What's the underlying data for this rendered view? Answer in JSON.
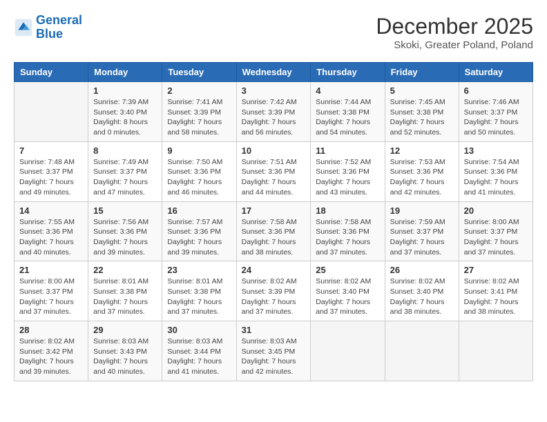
{
  "logo": {
    "text_general": "General",
    "text_blue": "Blue"
  },
  "title": "December 2025",
  "subtitle": "Skoki, Greater Poland, Poland",
  "headers": [
    "Sunday",
    "Monday",
    "Tuesday",
    "Wednesday",
    "Thursday",
    "Friday",
    "Saturday"
  ],
  "weeks": [
    [
      {
        "day": "",
        "info": ""
      },
      {
        "day": "1",
        "info": "Sunrise: 7:39 AM\nSunset: 3:40 PM\nDaylight: 8 hours\nand 0 minutes."
      },
      {
        "day": "2",
        "info": "Sunrise: 7:41 AM\nSunset: 3:39 PM\nDaylight: 7 hours\nand 58 minutes."
      },
      {
        "day": "3",
        "info": "Sunrise: 7:42 AM\nSunset: 3:39 PM\nDaylight: 7 hours\nand 56 minutes."
      },
      {
        "day": "4",
        "info": "Sunrise: 7:44 AM\nSunset: 3:38 PM\nDaylight: 7 hours\nand 54 minutes."
      },
      {
        "day": "5",
        "info": "Sunrise: 7:45 AM\nSunset: 3:38 PM\nDaylight: 7 hours\nand 52 minutes."
      },
      {
        "day": "6",
        "info": "Sunrise: 7:46 AM\nSunset: 3:37 PM\nDaylight: 7 hours\nand 50 minutes."
      }
    ],
    [
      {
        "day": "7",
        "info": "Sunrise: 7:48 AM\nSunset: 3:37 PM\nDaylight: 7 hours\nand 49 minutes."
      },
      {
        "day": "8",
        "info": "Sunrise: 7:49 AM\nSunset: 3:37 PM\nDaylight: 7 hours\nand 47 minutes."
      },
      {
        "day": "9",
        "info": "Sunrise: 7:50 AM\nSunset: 3:36 PM\nDaylight: 7 hours\nand 46 minutes."
      },
      {
        "day": "10",
        "info": "Sunrise: 7:51 AM\nSunset: 3:36 PM\nDaylight: 7 hours\nand 44 minutes."
      },
      {
        "day": "11",
        "info": "Sunrise: 7:52 AM\nSunset: 3:36 PM\nDaylight: 7 hours\nand 43 minutes."
      },
      {
        "day": "12",
        "info": "Sunrise: 7:53 AM\nSunset: 3:36 PM\nDaylight: 7 hours\nand 42 minutes."
      },
      {
        "day": "13",
        "info": "Sunrise: 7:54 AM\nSunset: 3:36 PM\nDaylight: 7 hours\nand 41 minutes."
      }
    ],
    [
      {
        "day": "14",
        "info": "Sunrise: 7:55 AM\nSunset: 3:36 PM\nDaylight: 7 hours\nand 40 minutes."
      },
      {
        "day": "15",
        "info": "Sunrise: 7:56 AM\nSunset: 3:36 PM\nDaylight: 7 hours\nand 39 minutes."
      },
      {
        "day": "16",
        "info": "Sunrise: 7:57 AM\nSunset: 3:36 PM\nDaylight: 7 hours\nand 39 minutes."
      },
      {
        "day": "17",
        "info": "Sunrise: 7:58 AM\nSunset: 3:36 PM\nDaylight: 7 hours\nand 38 minutes."
      },
      {
        "day": "18",
        "info": "Sunrise: 7:58 AM\nSunset: 3:36 PM\nDaylight: 7 hours\nand 37 minutes."
      },
      {
        "day": "19",
        "info": "Sunrise: 7:59 AM\nSunset: 3:37 PM\nDaylight: 7 hours\nand 37 minutes."
      },
      {
        "day": "20",
        "info": "Sunrise: 8:00 AM\nSunset: 3:37 PM\nDaylight: 7 hours\nand 37 minutes."
      }
    ],
    [
      {
        "day": "21",
        "info": "Sunrise: 8:00 AM\nSunset: 3:37 PM\nDaylight: 7 hours\nand 37 minutes."
      },
      {
        "day": "22",
        "info": "Sunrise: 8:01 AM\nSunset: 3:38 PM\nDaylight: 7 hours\nand 37 minutes."
      },
      {
        "day": "23",
        "info": "Sunrise: 8:01 AM\nSunset: 3:38 PM\nDaylight: 7 hours\nand 37 minutes."
      },
      {
        "day": "24",
        "info": "Sunrise: 8:02 AM\nSunset: 3:39 PM\nDaylight: 7 hours\nand 37 minutes."
      },
      {
        "day": "25",
        "info": "Sunrise: 8:02 AM\nSunset: 3:40 PM\nDaylight: 7 hours\nand 37 minutes."
      },
      {
        "day": "26",
        "info": "Sunrise: 8:02 AM\nSunset: 3:40 PM\nDaylight: 7 hours\nand 38 minutes."
      },
      {
        "day": "27",
        "info": "Sunrise: 8:02 AM\nSunset: 3:41 PM\nDaylight: 7 hours\nand 38 minutes."
      }
    ],
    [
      {
        "day": "28",
        "info": "Sunrise: 8:02 AM\nSunset: 3:42 PM\nDaylight: 7 hours\nand 39 minutes."
      },
      {
        "day": "29",
        "info": "Sunrise: 8:03 AM\nSunset: 3:43 PM\nDaylight: 7 hours\nand 40 minutes."
      },
      {
        "day": "30",
        "info": "Sunrise: 8:03 AM\nSunset: 3:44 PM\nDaylight: 7 hours\nand 41 minutes."
      },
      {
        "day": "31",
        "info": "Sunrise: 8:03 AM\nSunset: 3:45 PM\nDaylight: 7 hours\nand 42 minutes."
      },
      {
        "day": "",
        "info": ""
      },
      {
        "day": "",
        "info": ""
      },
      {
        "day": "",
        "info": ""
      }
    ]
  ]
}
